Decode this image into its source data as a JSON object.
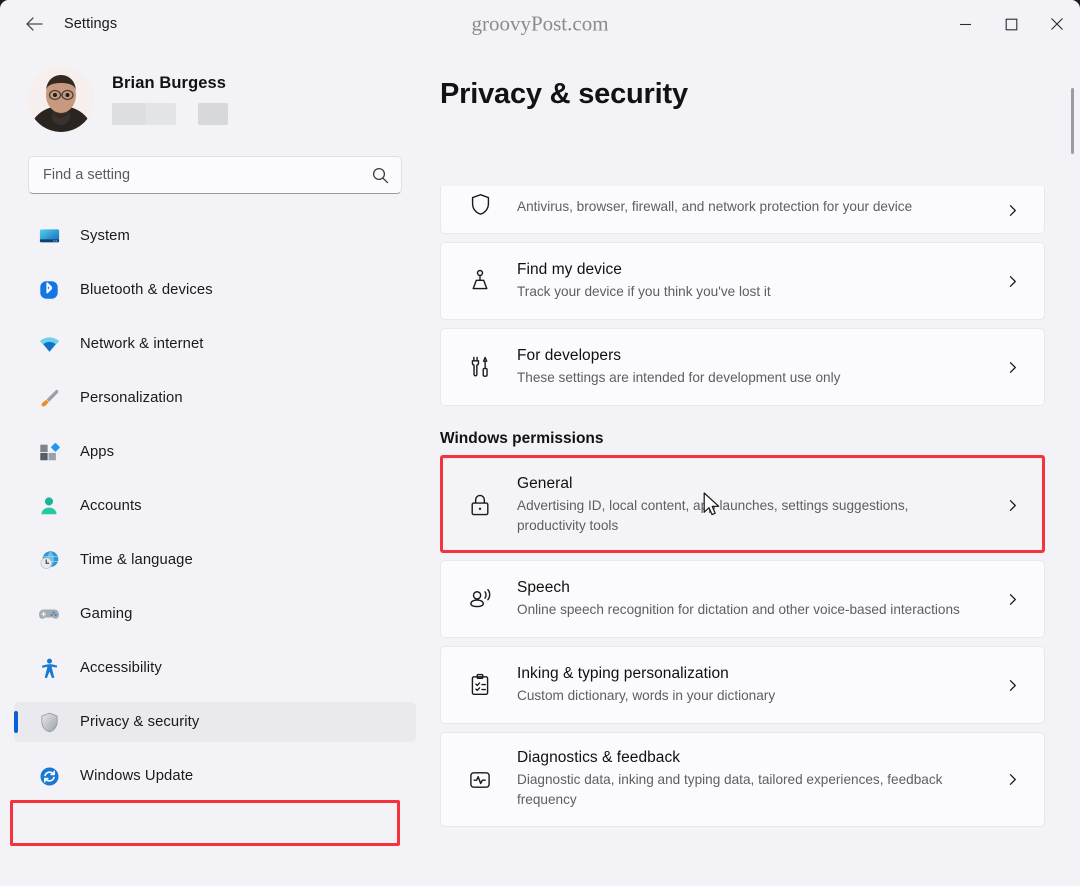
{
  "window": {
    "app_title": "Settings",
    "watermark": "groovyPost.com",
    "controls": {
      "minimize": "Minimize",
      "maximize": "Maximize",
      "close": "Close"
    }
  },
  "sidebar": {
    "profile": {
      "name": "Brian Burgess"
    },
    "search": {
      "placeholder": "Find a setting",
      "value": ""
    },
    "items": [
      {
        "label": "System",
        "icon": "monitor-icon",
        "selected": false
      },
      {
        "label": "Bluetooth & devices",
        "icon": "bluetooth-icon",
        "selected": false
      },
      {
        "label": "Network & internet",
        "icon": "wifi-icon",
        "selected": false
      },
      {
        "label": "Personalization",
        "icon": "paintbrush-icon",
        "selected": false
      },
      {
        "label": "Apps",
        "icon": "apps-icon",
        "selected": false
      },
      {
        "label": "Accounts",
        "icon": "person-icon",
        "selected": false
      },
      {
        "label": "Time & language",
        "icon": "globe-clock-icon",
        "selected": false
      },
      {
        "label": "Gaming",
        "icon": "gamepad-icon",
        "selected": false
      },
      {
        "label": "Accessibility",
        "icon": "accessibility-icon",
        "selected": false
      },
      {
        "label": "Privacy & security",
        "icon": "shield-icon",
        "selected": true
      },
      {
        "label": "Windows Update",
        "icon": "update-icon",
        "selected": false
      }
    ]
  },
  "main": {
    "page_title": "Privacy & security",
    "clipped_card": {
      "desc": "Antivirus, browser, firewall, and network protection for your device",
      "icon": "shield-outline-icon"
    },
    "cards_top": [
      {
        "title": "Find my device",
        "desc": "Track your device if you think you've lost it",
        "icon": "location-pin-icon"
      },
      {
        "title": "For developers",
        "desc": "These settings are intended for development use only",
        "icon": "tools-icon"
      }
    ],
    "section_heading": "Windows permissions",
    "cards_permissions": [
      {
        "title": "General",
        "desc": "Advertising ID, local content, app launches, settings suggestions, productivity tools",
        "icon": "lock-icon",
        "highlighted": true
      },
      {
        "title": "Speech",
        "desc": "Online speech recognition for dictation and other voice-based interactions",
        "icon": "speech-icon",
        "highlighted": false
      },
      {
        "title": "Inking & typing personalization",
        "desc": "Custom dictionary, words in your dictionary",
        "icon": "clipboard-icon",
        "highlighted": false
      },
      {
        "title": "Diagnostics & feedback",
        "desc": "Diagnostic data, inking and typing data, tailored experiences, feedback frequency",
        "icon": "pulse-icon",
        "highlighted": false
      }
    ]
  },
  "annotations": {
    "highlight_color": "#f5333f",
    "accent_color": "#0a5fd6"
  }
}
